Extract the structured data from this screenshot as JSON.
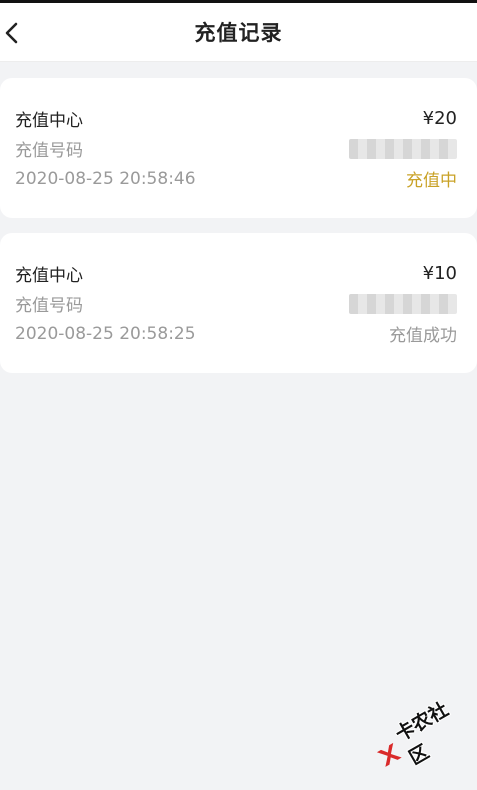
{
  "header": {
    "title": "充值记录"
  },
  "records": [
    {
      "name": "充值中心",
      "amount": "¥20",
      "number_label": "充值号码",
      "time": "2020-08-25 20:58:46",
      "status": "充值中",
      "status_color": "#c9a227"
    },
    {
      "name": "充值中心",
      "amount": "¥10",
      "number_label": "充值号码",
      "time": "2020-08-25 20:58:25",
      "status": "充值成功",
      "status_color": "#9a9a9a"
    }
  ],
  "watermark": {
    "text": "卡农社区"
  },
  "colors": {
    "background": "#f2f3f5",
    "card": "#ffffff",
    "accent_pending": "#c9a227",
    "logo_red": "#d92a2a"
  }
}
